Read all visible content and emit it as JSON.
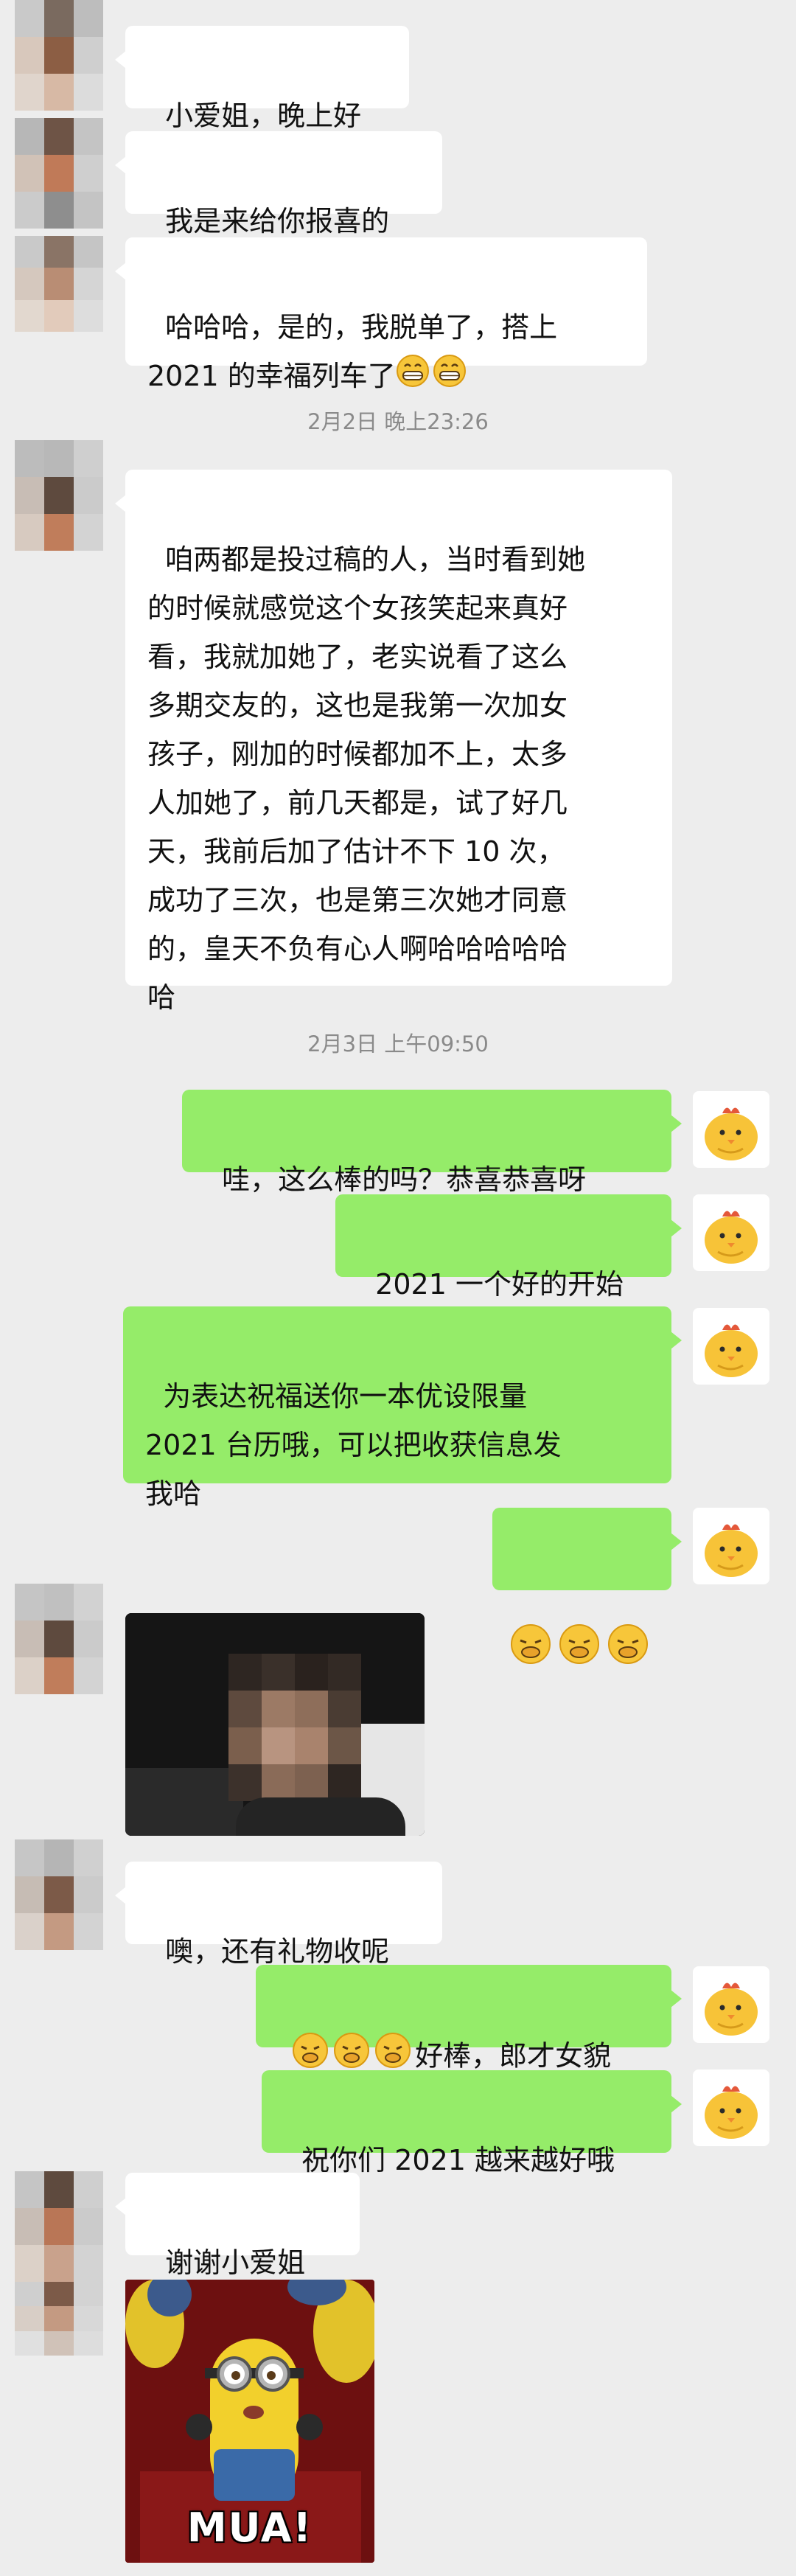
{
  "messages": {
    "m1": "小爱姐，晚上好",
    "m2": "我是来给你报喜的",
    "m3": "哈哈哈，是的，我脱单了，搭上\n2021 的幸福列车了",
    "ts1": "2月2日 晚上23:26",
    "m4": "咱两都是投过稿的人，当时看到她\n的时候就感觉这个女孩笑起来真好\n看，我就加她了，老实说看了这么\n多期交友的，这也是我第一次加女\n孩子，刚加的时候都加不上，太多\n人加她了，前几天都是，试了好几\n天，我前后加了估计不下 10 次，\n成功了三次，也是第三次她才同意\n的，皇天不负有心人啊哈哈哈哈哈\n哈",
    "ts2": "2月3日 上午09:50",
    "m5": "哇，这么棒的吗？恭喜恭喜呀",
    "m6": "2021 一个好的开始",
    "m7": "为表达祝福送你一本优设限量\n2021 台历哦，可以把收获信息发\n我哈",
    "m9": "噢，还有礼物收呢",
    "m10": "好棒，郎才女貌",
    "m11": "祝你们 2021 越来越好哦",
    "m12": "谢谢小爱姐",
    "sticker_text": "MUA!"
  },
  "colors": {
    "background": "#ededed",
    "bubble_other": "#ffffff",
    "bubble_self": "#95ec69",
    "timestamp": "#8a8a8a"
  },
  "icons": [
    "grin-emoji",
    "fist-emoji",
    "chick-avatar",
    "pixelated-avatar",
    "minion-sticker"
  ]
}
